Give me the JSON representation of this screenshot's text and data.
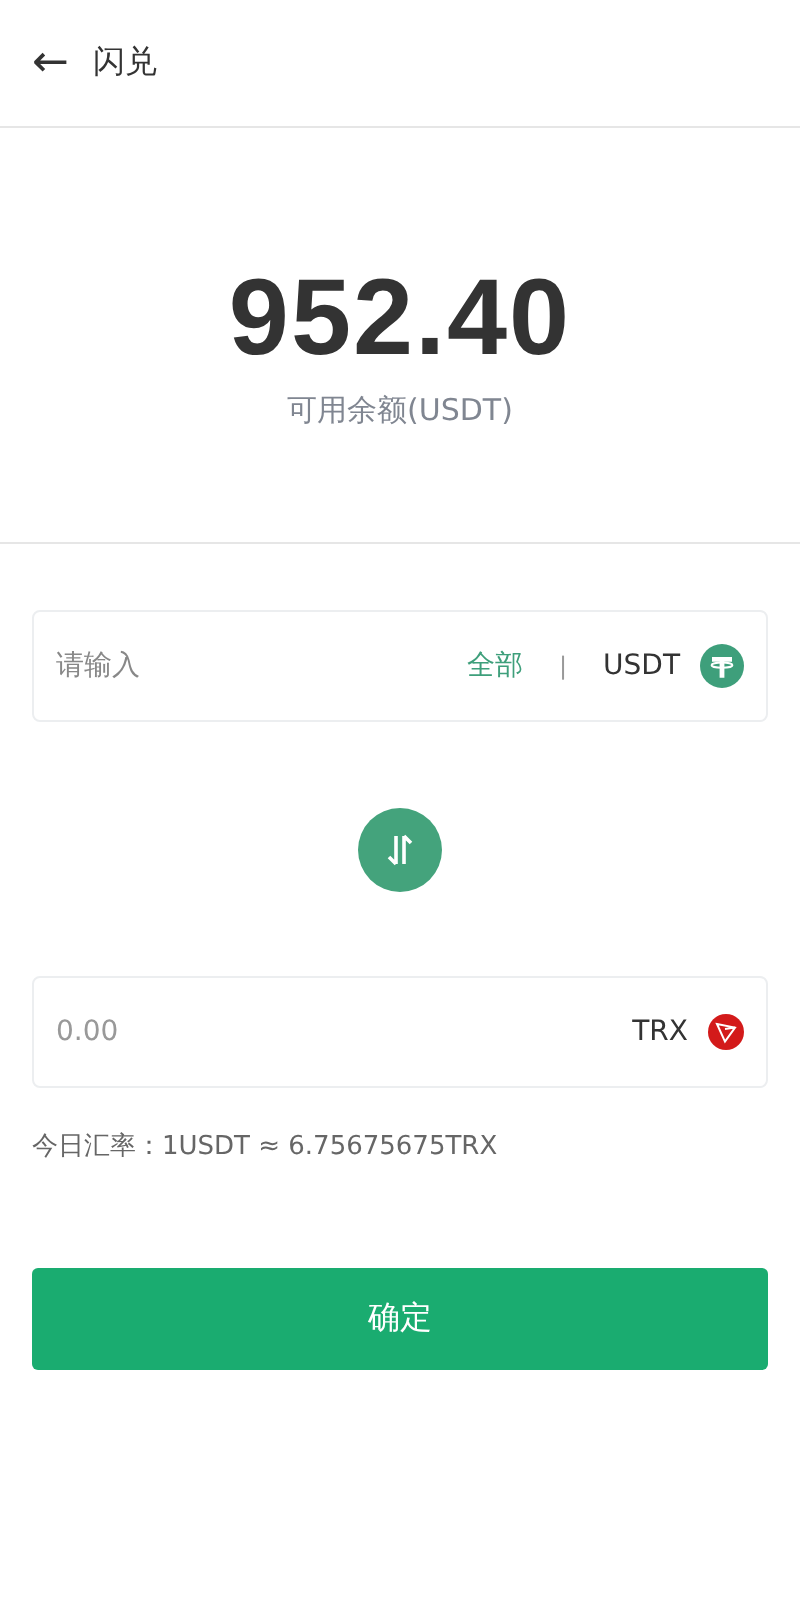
{
  "header": {
    "back": "←",
    "title": "闪兑"
  },
  "balance": {
    "amount": "952.40",
    "label": "可用余额(USDT)"
  },
  "from": {
    "placeholder": "请输入",
    "all": "全部",
    "separator": "|",
    "currency": "USDT",
    "kind": "tether"
  },
  "to": {
    "value": "0.00",
    "currency": "TRX",
    "kind": "tron"
  },
  "rate": "今日汇率：1USDT ≈ 6.75675675TRX",
  "confirm": "确定"
}
